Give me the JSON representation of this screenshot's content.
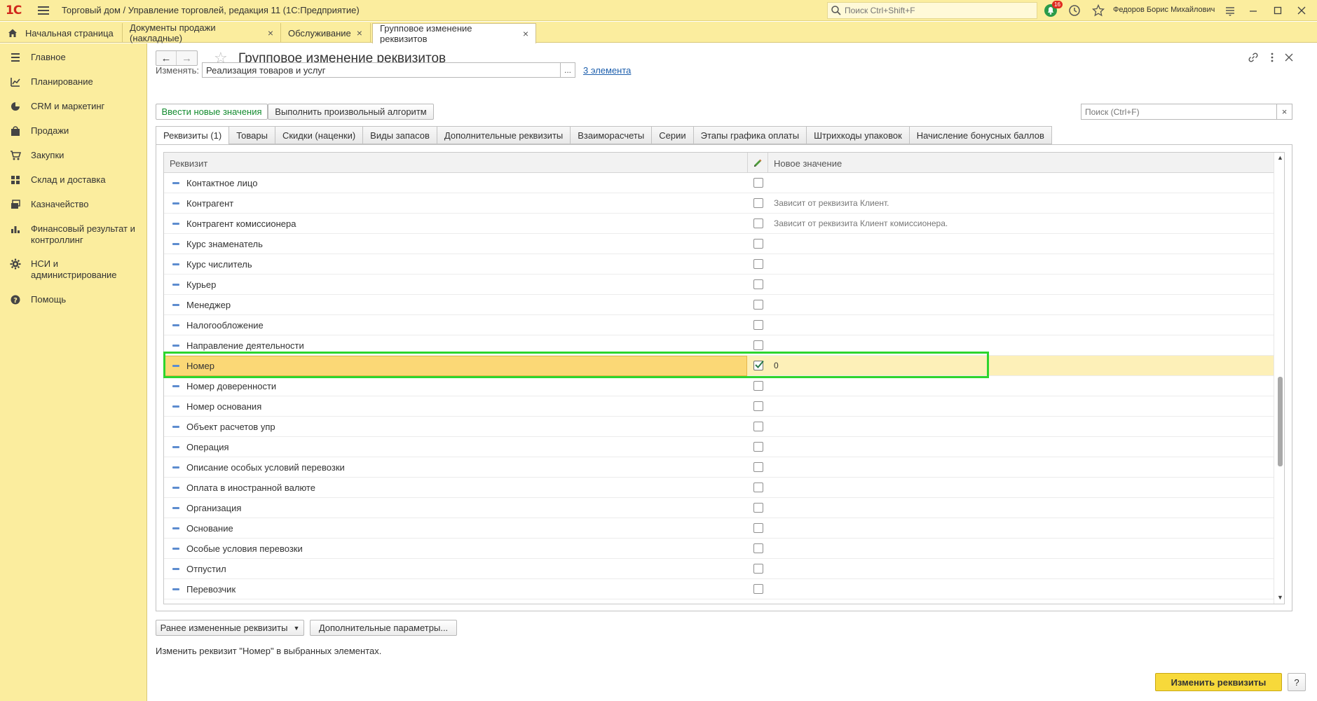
{
  "app": {
    "logo": "1С",
    "title": "Торговый дом / Управление торговлей, редакция 11  (1С:Предприятие)",
    "search_placeholder": "Поиск Ctrl+Shift+F",
    "notifications_count": "16",
    "user": "Федоров Борис Михайлович"
  },
  "tabs": [
    {
      "label": "Начальная страница"
    },
    {
      "label": "Документы продажи (накладные)",
      "close": "×"
    },
    {
      "label": "Обслуживание",
      "close": "×"
    },
    {
      "label": "Групповое изменение реквизитов",
      "close": "×"
    }
  ],
  "sidebar": {
    "items": [
      {
        "label": "Главное",
        "icon": "menu-icon"
      },
      {
        "label": "Планирование",
        "icon": "planning-icon"
      },
      {
        "label": "CRM и маркетинг",
        "icon": "pie-chart-icon"
      },
      {
        "label": "Продажи",
        "icon": "bag-icon"
      },
      {
        "label": "Закупки",
        "icon": "cart-icon"
      },
      {
        "label": "Склад и доставка",
        "icon": "warehouse-icon"
      },
      {
        "label": "Казначейство",
        "icon": "treasury-icon"
      },
      {
        "label": "Финансовый результат и контроллинг",
        "icon": "bar-chart-icon"
      },
      {
        "label": "НСИ и администрирование",
        "icon": "gear-icon"
      },
      {
        "label": "Помощь",
        "icon": "help-icon"
      }
    ]
  },
  "form": {
    "title": "Групповое изменение реквизитов",
    "change_label": "Изменять:",
    "change_value": "Реализация товаров и услуг",
    "ellipsis": "...",
    "elements_link": "3 элемента",
    "btn_new_values": "Ввести новые значения",
    "btn_algorithm": "Выполнить произвольный алгоритм",
    "search_placeholder": "Поиск (Ctrl+F)",
    "search_clear": "×"
  },
  "form_tabs": [
    {
      "label": "Реквизиты (1)"
    },
    {
      "label": "Товары"
    },
    {
      "label": "Скидки (наценки)"
    },
    {
      "label": "Виды запасов"
    },
    {
      "label": "Дополнительные реквизиты"
    },
    {
      "label": "Взаиморасчеты"
    },
    {
      "label": "Серии"
    },
    {
      "label": "Этапы графика оплаты"
    },
    {
      "label": "Штрихкоды упаковок"
    },
    {
      "label": "Начисление бонусных баллов"
    }
  ],
  "table": {
    "col_attr": "Реквизит",
    "col_new": "Новое значение",
    "rows": [
      {
        "name": "Контактное лицо",
        "checked": false,
        "value": ""
      },
      {
        "name": "Контрагент",
        "checked": false,
        "value": "Зависит от реквизита Клиент."
      },
      {
        "name": "Контрагент комиссионера",
        "checked": false,
        "value": "Зависит от реквизита Клиент комиссионера."
      },
      {
        "name": "Курс знаменатель",
        "checked": false,
        "value": ""
      },
      {
        "name": "Курс числитель",
        "checked": false,
        "value": ""
      },
      {
        "name": "Курьер",
        "checked": false,
        "value": ""
      },
      {
        "name": "Менеджер",
        "checked": false,
        "value": ""
      },
      {
        "name": "Налогообложение",
        "checked": false,
        "value": ""
      },
      {
        "name": "Направление деятельности",
        "checked": false,
        "value": ""
      },
      {
        "name": "Номер",
        "checked": true,
        "value": "0",
        "selected": true
      },
      {
        "name": "Номер доверенности",
        "checked": false,
        "value": ""
      },
      {
        "name": "Номер основания",
        "checked": false,
        "value": ""
      },
      {
        "name": "Объект расчетов упр",
        "checked": false,
        "value": ""
      },
      {
        "name": "Операция",
        "checked": false,
        "value": ""
      },
      {
        "name": "Описание особых условий перевозки",
        "checked": false,
        "value": ""
      },
      {
        "name": "Оплата в иностранной валюте",
        "checked": false,
        "value": ""
      },
      {
        "name": "Организация",
        "checked": false,
        "value": ""
      },
      {
        "name": "Основание",
        "checked": false,
        "value": ""
      },
      {
        "name": "Особые условия перевозки",
        "checked": false,
        "value": ""
      },
      {
        "name": "Отпустил",
        "checked": false,
        "value": ""
      },
      {
        "name": "Перевозчик",
        "checked": false,
        "value": ""
      }
    ]
  },
  "footer": {
    "btn_prev": "Ранее измененные реквизиты",
    "btn_extra": "Дополнительные параметры...",
    "status": "Изменить реквизит \"Номер\" в выбранных элементах.",
    "btn_apply": "Изменить реквизиты",
    "btn_help": "?"
  },
  "colors": {
    "accent_yellow": "#fbed9e",
    "highlight_green": "#2ed52e",
    "primary_button": "#f7d93a",
    "link_blue": "#1d5fad"
  }
}
